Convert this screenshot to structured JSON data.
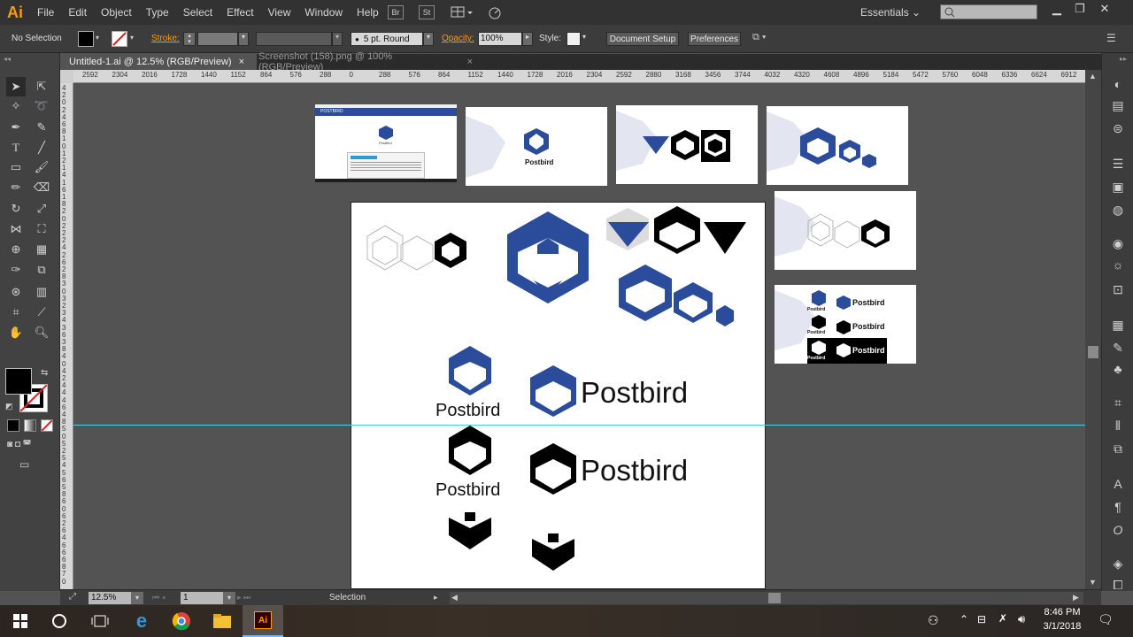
{
  "app": {
    "logo": "Ai"
  },
  "menu": [
    "File",
    "Edit",
    "Object",
    "Type",
    "Select",
    "Effect",
    "View",
    "Window",
    "Help"
  ],
  "menu_buttons": {
    "bridge": "Br",
    "stock": "St"
  },
  "workspace": {
    "label": "Essentials ⌄"
  },
  "control": {
    "selection": "No Selection",
    "stroke_label": "Stroke:",
    "brush": "5 pt. Round",
    "opacity_label": "Opacity:",
    "opacity_value": "100%",
    "style_label": "Style:",
    "document_setup": "Document Setup",
    "preferences": "Preferences"
  },
  "tabs": [
    {
      "label": "Untitled-1.ai @ 12.5% (RGB/Preview)",
      "close": "×"
    },
    {
      "label": "Screenshot (158).png @ 100% (RGB/Preview)",
      "close": "×"
    }
  ],
  "ruler_h": [
    "2592",
    "2304",
    "2016",
    "1728",
    "1440",
    "1152",
    "864",
    "576",
    "288",
    "0",
    "288",
    "576",
    "864",
    "1152",
    "1440",
    "1728",
    "2016",
    "2304",
    "2592",
    "2880",
    "3168",
    "3456",
    "3744",
    "4032",
    "4320",
    "4608",
    "4896",
    "5184",
    "5472",
    "5760",
    "6048",
    "6336",
    "6624",
    "6912"
  ],
  "ruler_v": [
    "4",
    "2",
    "0",
    "2",
    "4",
    "6",
    "8",
    "1",
    "0",
    "1",
    "2",
    "1",
    "4",
    "1",
    "6",
    "1",
    "8",
    "2",
    "0",
    "2",
    "2",
    "2",
    "4",
    "2",
    "6",
    "2",
    "8",
    "3",
    "0",
    "3",
    "2",
    "3",
    "4",
    "3",
    "6",
    "3",
    "8",
    "4",
    "0",
    "4",
    "2",
    "4",
    "4",
    "4",
    "6",
    "4",
    "8",
    "5",
    "0",
    "5",
    "2",
    "5",
    "4",
    "5",
    "6",
    "5",
    "8",
    "6",
    "0",
    "6",
    "2",
    "6",
    "4",
    "6",
    "6",
    "6",
    "8",
    "7",
    "0"
  ],
  "artwork": {
    "brand": "Postbird",
    "thumb_brand": "Postbird",
    "thumb_header": "POSTBIRD"
  },
  "status": {
    "zoom": "12.5%",
    "page": "1",
    "tool": "Selection"
  },
  "taskbar": {
    "time": "8:46 PM",
    "date": "3/1/2018"
  },
  "colors": {
    "brand_blue": "#2b4c9b",
    "guide": "#3fd6e6",
    "accent": "#ff9a00"
  }
}
